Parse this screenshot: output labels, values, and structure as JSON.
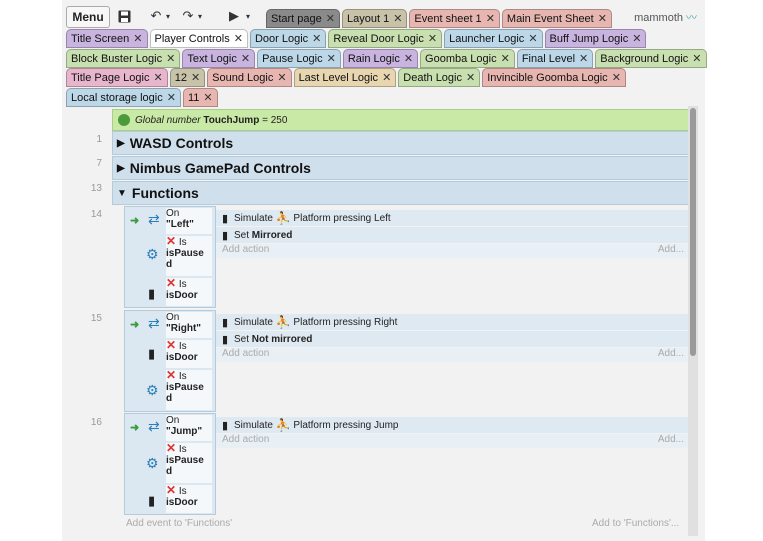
{
  "toolbar": {
    "menu_label": "Menu",
    "save_icon": "save-icon",
    "undo_icon": "undo-icon",
    "redo_icon": "redo-icon",
    "play_icon": "play-icon",
    "brand": "mammoth"
  },
  "tabs_row1": [
    {
      "label": "Start page",
      "color": "#8a8a8a"
    },
    {
      "label": "Layout 1",
      "color": "#c8c2a8"
    },
    {
      "label": "Event sheet 1",
      "color": "#e8b6b0"
    },
    {
      "label": "Main Event Sheet",
      "color": "#e8b6b0"
    }
  ],
  "tabs_row2": [
    {
      "label": "Title Screen",
      "color": "#c9b3df"
    },
    {
      "label": "Player Controls",
      "color": "#ffffff",
      "active": true
    },
    {
      "label": "Door Logic",
      "color": "#bcd8e8"
    },
    {
      "label": "Reveal Door Logic",
      "color": "#c8e0b0"
    },
    {
      "label": "Launcher Logic",
      "color": "#bcd8e8"
    },
    {
      "label": "Buff Jump Logic",
      "color": "#c9b3df"
    }
  ],
  "tabs_row3": [
    {
      "label": "Block Buster Logic",
      "color": "#c8e0b0"
    },
    {
      "label": "Text Logic",
      "color": "#c9b3df"
    },
    {
      "label": "Pause Logic",
      "color": "#bcd8e8"
    },
    {
      "label": "Rain Logic",
      "color": "#c9b3df"
    },
    {
      "label": "Goomba Logic",
      "color": "#c8e0b0"
    },
    {
      "label": "Final Level",
      "color": "#bcd8e8"
    },
    {
      "label": "Background Logic",
      "color": "#c8e0b0"
    }
  ],
  "tabs_row4": [
    {
      "label": "Title Page Logic",
      "color": "#e8b6cc"
    },
    {
      "label": "12",
      "color": "#c8c2a8"
    },
    {
      "label": "Sound Logic",
      "color": "#e8b6b0"
    },
    {
      "label": "Last Level Logic",
      "color": "#e8d6b0"
    },
    {
      "label": "Death Logic",
      "color": "#c8e0b0"
    },
    {
      "label": "Invincible Goomba Logic",
      "color": "#e8b6b0"
    }
  ],
  "tabs_row5": [
    {
      "label": "Local storage logic",
      "color": "#bcd8e8"
    },
    {
      "label": "11",
      "color": "#e8b6b0"
    }
  ],
  "global": {
    "prefix": "Global number",
    "name": "TouchJump",
    "value": "= 250"
  },
  "groups": [
    {
      "line": "1",
      "label": "WASD Controls",
      "arrow": "▶"
    },
    {
      "line": "7",
      "label": "Nimbus GamePad Controls",
      "arrow": "▶"
    },
    {
      "line": "13",
      "label": "Functions",
      "arrow": "▼"
    }
  ],
  "events": [
    {
      "line": "14",
      "trigger": {
        "on": "On",
        "name": "\"Left\""
      },
      "conditions": [
        {
          "is": "Is",
          "var": "isPause",
          "var2": "d"
        },
        {
          "is": "Is",
          "var": "isDoor",
          "var2": ""
        }
      ],
      "actions": [
        {
          "prefix": "Simulate",
          "text": "Platform pressing Left"
        },
        {
          "prefix": "Set",
          "text": "Mirrored"
        }
      ]
    },
    {
      "line": "15",
      "trigger": {
        "on": "On",
        "name": "\"Right\""
      },
      "conditions": [
        {
          "is": "Is",
          "var": "isDoor",
          "var2": ""
        },
        {
          "is": "Is",
          "var": "isPause",
          "var2": "d"
        }
      ],
      "actions": [
        {
          "prefix": "Simulate",
          "text": "Platform pressing Right"
        },
        {
          "prefix": "Set",
          "text": "Not mirrored"
        }
      ]
    },
    {
      "line": "16",
      "trigger": {
        "on": "On",
        "name": "\"Jump\""
      },
      "conditions": [
        {
          "is": "Is",
          "var": "isPause",
          "var2": "d"
        },
        {
          "is": "Is",
          "var": "isDoor",
          "var2": ""
        }
      ],
      "actions": [
        {
          "prefix": "Simulate",
          "text": "Platform pressing Jump"
        }
      ]
    }
  ],
  "add_action": "Add action",
  "add_short": "Add...",
  "add_event_functions": "Add event to 'Functions'",
  "add_to_functions": "Add to 'Functions'..."
}
